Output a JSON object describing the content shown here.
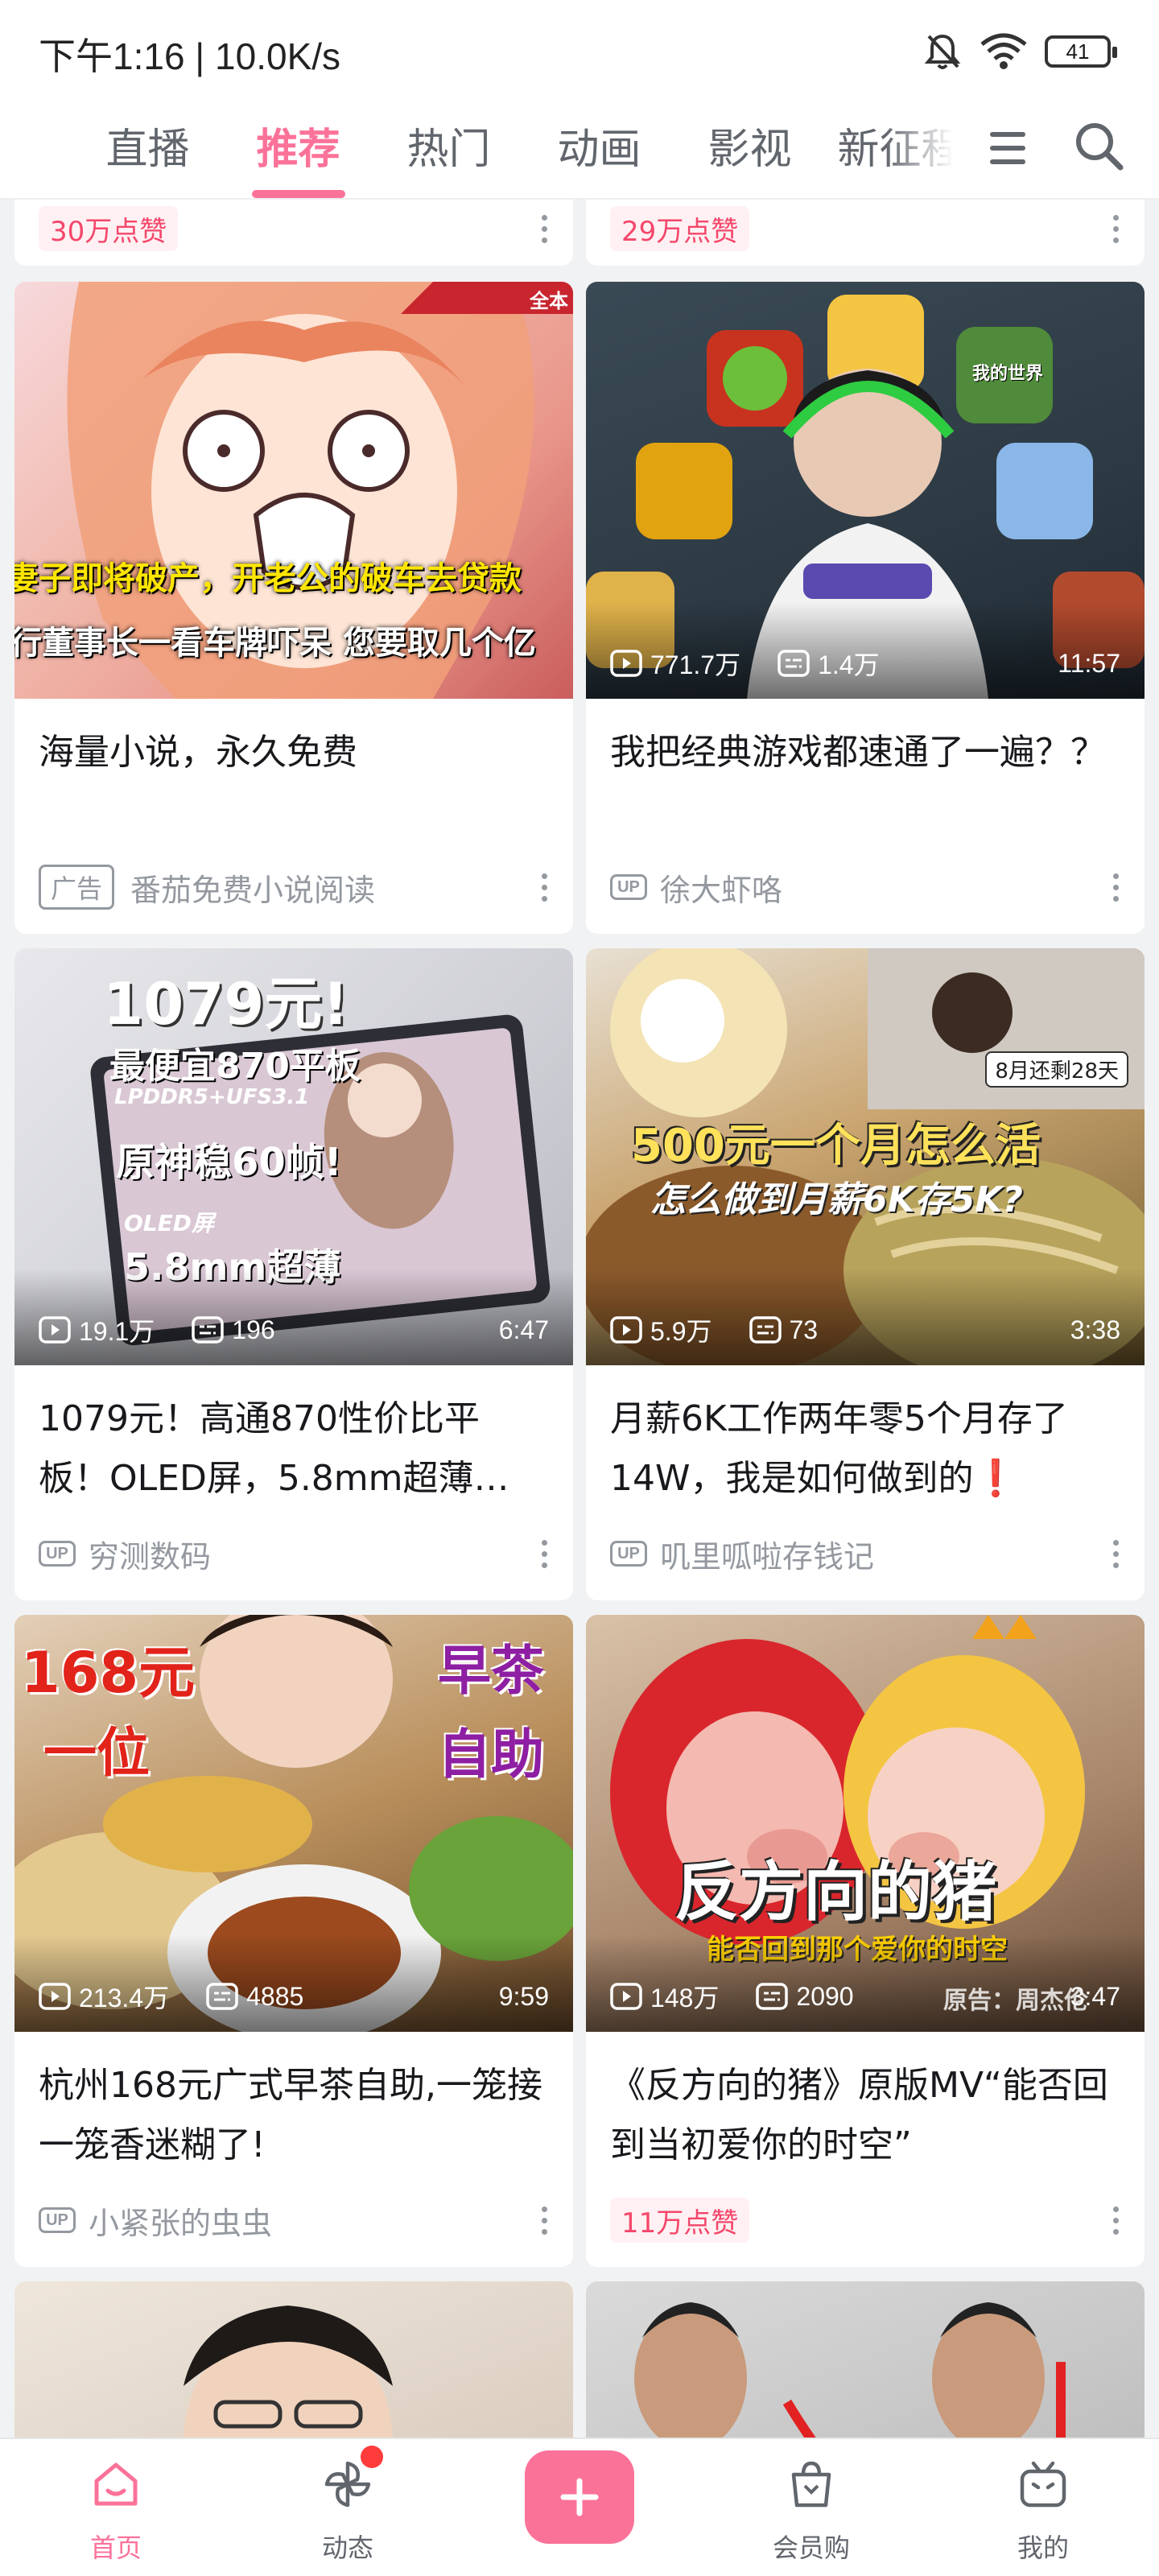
{
  "status": {
    "time": "下午1:16 | 10.0K/s",
    "battery": "41"
  },
  "tabs": [
    {
      "label": "直播"
    },
    {
      "label": "推荐",
      "active": true
    },
    {
      "label": "热门"
    },
    {
      "label": "动画"
    },
    {
      "label": "影视"
    },
    {
      "label": "新征程"
    }
  ],
  "top_partial": {
    "left_likes": "30万点赞",
    "right_likes": "29万点赞"
  },
  "cards": [
    {
      "thumb_lines": [
        "妻子即将破产，开老公的破车去贷款",
        "行董事长一看车牌吓呆 您要取几个亿"
      ],
      "corner_tag": "全本",
      "title": "海量小说，永久免费",
      "ad_label": "广告",
      "owner": "番茄免费小说阅读"
    },
    {
      "thumb_lines": [
        "我的世界"
      ],
      "views": "771.7万",
      "danmaku": "1.4万",
      "duration": "11:57",
      "title": "我把经典游戏都速通了一遍？？",
      "up_label": "UP",
      "owner": "徐大虾咯"
    },
    {
      "thumb_lines": [
        "1079元!",
        "最便宜870平板",
        "LPDDR5+UFS3.1",
        "原神稳60帧!",
        "OLED屏",
        "5.8mm超薄"
      ],
      "views": "19.1万",
      "danmaku": "196",
      "duration": "6:47",
      "title": "1079元！高通870性价比平板！OLED屏，5.8mm超薄…",
      "up_label": "UP",
      "owner": "穷测数码"
    },
    {
      "thumb_lines": [
        "8月还剩28天",
        "500元一个月怎么活",
        "怎么做到月薪6K存5K?"
      ],
      "views": "5.9万",
      "danmaku": "73",
      "duration": "3:38",
      "title": "月薪6K工作两年零5个月存了14W，我是如何做到的❗",
      "up_label": "UP",
      "owner": "叽里呱啦存钱记"
    },
    {
      "thumb_lines": [
        "168元",
        "一位",
        "早茶",
        "自助"
      ],
      "views": "213.4万",
      "danmaku": "4885",
      "duration": "9:59",
      "title": "杭州168元广式早茶自助,一笼接一笼香迷糊了!",
      "up_label": "UP",
      "owner": "小紧张的虫虫"
    },
    {
      "thumb_lines": [
        "反方向的猪",
        "能否回到那个爱你的时空",
        "原告：周杰伦"
      ],
      "views": "148万",
      "danmaku": "2090",
      "duration": "3:47",
      "title": "《反方向的猪》原版MV“能否回到当初爱你的时空”",
      "likes": "11万点赞"
    }
  ],
  "bottom_nav": [
    {
      "label": "首页",
      "icon": "home-icon",
      "active": true
    },
    {
      "label": "动态",
      "icon": "pinwheel-icon"
    },
    {
      "label": "",
      "icon": "plus-icon"
    },
    {
      "label": "会员购",
      "icon": "shopping-bag-icon"
    },
    {
      "label": "我的",
      "icon": "tv-icon"
    }
  ],
  "colors": {
    "accent": "#fb7299",
    "background": "#f1f2f3",
    "card": "#ffffff",
    "muted": "#9499a0"
  }
}
